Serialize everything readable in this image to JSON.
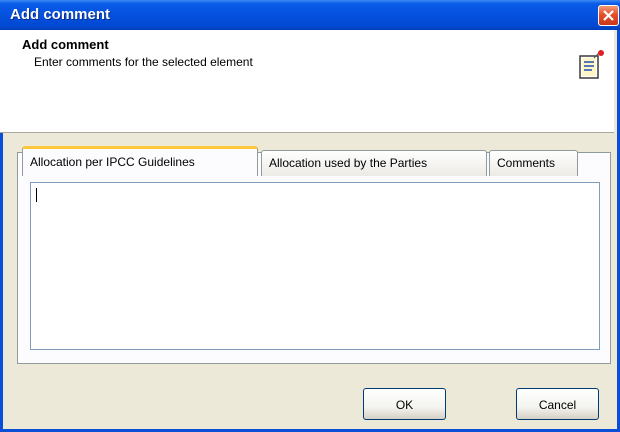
{
  "window": {
    "title": "Add comment"
  },
  "header": {
    "title": "Add comment",
    "subtitle": "Enter comments for the selected element",
    "icon": "notepad-pin-icon"
  },
  "tabs": [
    {
      "label": "Allocation per IPCC Guidelines",
      "active": true
    },
    {
      "label": "Allocation used by the Parties",
      "active": false
    },
    {
      "label": "Comments",
      "active": false
    }
  ],
  "comment_text": "",
  "buttons": {
    "ok": "OK",
    "cancel": "Cancel"
  },
  "colors": {
    "titlebar": "#0552df",
    "close": "#e5502a",
    "tab_accent": "#ffc83c",
    "face": "#ece9d8"
  }
}
